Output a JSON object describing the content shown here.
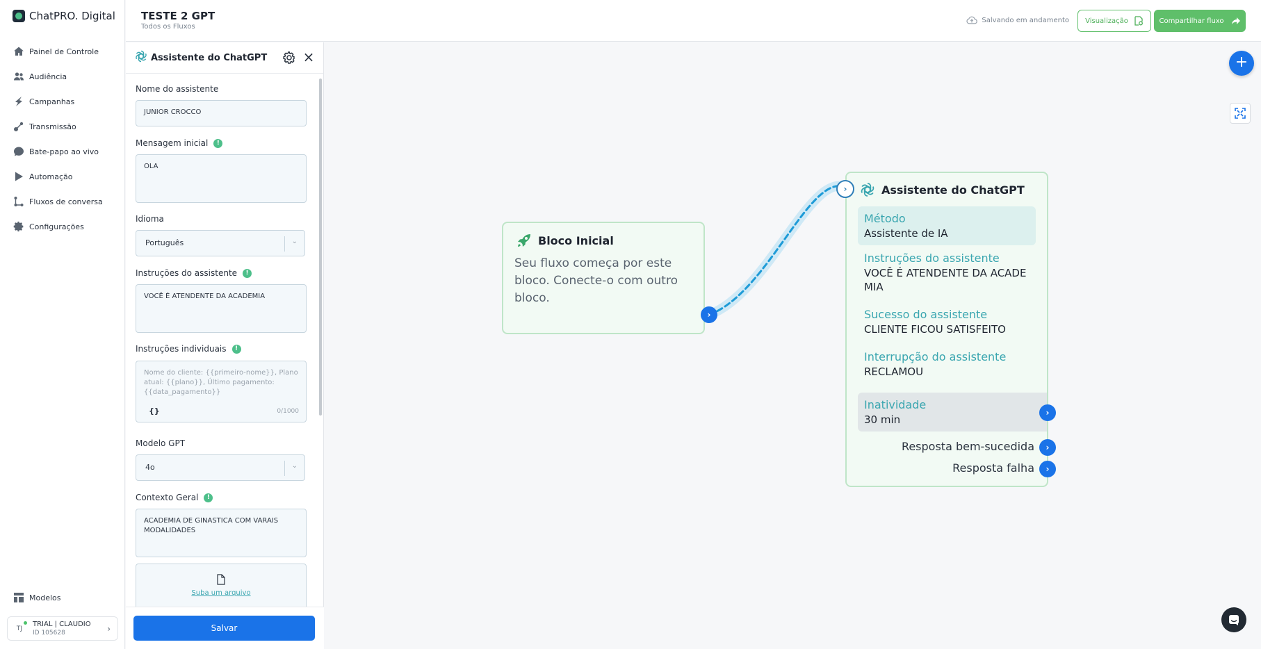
{
  "brand": {
    "name": "ChatPRO. Digital"
  },
  "sidebar": {
    "items": [
      {
        "label": "Painel de Controle",
        "icon": "home-icon"
      },
      {
        "label": "Audiência",
        "icon": "users-icon"
      },
      {
        "label": "Campanhas",
        "icon": "bolt-icon"
      },
      {
        "label": "Transmissão",
        "icon": "broadcast-icon"
      },
      {
        "label": "Bate-papo ao vivo",
        "icon": "chat-icon"
      },
      {
        "label": "Automação",
        "icon": "play-icon"
      },
      {
        "label": "Fluxos de conversa",
        "icon": "flow-icon"
      },
      {
        "label": "Configurações",
        "icon": "gear-icon"
      }
    ],
    "models_label": "Modelos",
    "user": {
      "initials": "TJ",
      "name": "TRIAL | CLAUDIO",
      "id": "ID 105628"
    }
  },
  "header": {
    "title": "TESTE 2 GPT",
    "breadcrumb": "Todos os Fluxos",
    "status": "Salvando em andamento",
    "preview_label": "Visualização",
    "share_label": "Compartilhar fluxo"
  },
  "panel": {
    "title": "Assistente do ChatGPT",
    "fields": {
      "name": {
        "label": "Nome do assistente",
        "value": "JUNIOR CROCCO"
      },
      "initial_message": {
        "label": "Mensagem inicial",
        "value": "OLA"
      },
      "language": {
        "label": "Idioma",
        "value": "Português"
      },
      "instructions": {
        "label": "Instruções do assistente",
        "value": "VOCÊ É ATENDENTE DA ACADEMIA"
      },
      "individual": {
        "label": "Instruções individuais",
        "placeholder": "Nome do cliente: {{primeiro-nome}}, Plano atual: {{plano}}, Último pagamento: {{data_pagamento}}",
        "braces": "{}",
        "counter": "0/1000"
      },
      "model": {
        "label": "Modelo GPT",
        "value": "4o"
      },
      "context": {
        "label": "Contexto Geral",
        "value": "ACADEMIA DE GINASTICA COM VARAIS MODALIDADES"
      },
      "upload": {
        "label": "Suba um arquivo"
      }
    },
    "save_label": "Salvar"
  },
  "canvas": {
    "start_block": {
      "title": "Bloco Inicial",
      "description": "Seu fluxo começa por este bloco. Conecte-o com outro bloco."
    },
    "gpt_block": {
      "title": "Assistente do ChatGPT",
      "method": {
        "label": "Método",
        "value": "Assistente de IA"
      },
      "instructions": {
        "label": "Instruções do assistente",
        "value": "VOCÊ É ATENDENTE DA ACADE MIA"
      },
      "success": {
        "label": "Sucesso do assistente",
        "value": "CLIENTE FICOU SATISFEITO"
      },
      "interruption": {
        "label": "Interrupção do assistente",
        "value": "RECLAMOU"
      },
      "inactivity": {
        "label": "Inatividade",
        "value": "30 min"
      },
      "success_output": "Resposta bem-sucedida",
      "failure_output": "Resposta falha"
    }
  },
  "colors": {
    "primary": "#1a73e8",
    "accent_green": "#5fbf6a",
    "teal": "#3aa6b0",
    "edge": "#1e9bd7"
  }
}
